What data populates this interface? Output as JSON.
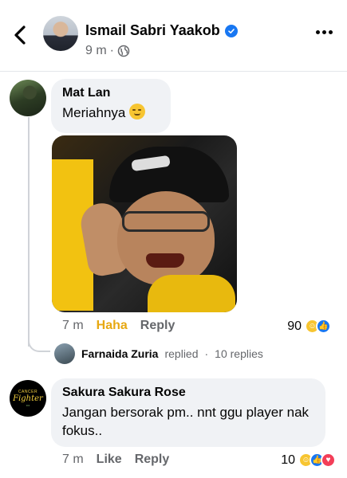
{
  "header": {
    "name": "Ismail Sabri Yaakob",
    "time": "9 m",
    "separator": "·",
    "back_icon": "chevron-left-icon",
    "verified_icon": "verified-badge-icon",
    "privacy_icon": "globe-icon",
    "more_icon": "more-horizontal-icon"
  },
  "comments": [
    {
      "author": "Mat Lan",
      "text": "Meriahnya",
      "emoji": "smirking-face-emoji",
      "attachment": "photo",
      "time": "7 m",
      "reaction_label": "Haha",
      "reply_label": "Reply",
      "reaction_count": "90",
      "reaction_icons": [
        "haha",
        "like"
      ],
      "reply_summary": {
        "name": "Farnaida Zuria",
        "replied": "replied",
        "separator": "·",
        "count": "10 replies"
      }
    },
    {
      "author": "Sakura Sakura Rose",
      "text": "Jangan bersorak pm.. nnt ggu player nak fokus..",
      "time": "7 m",
      "like_label": "Like",
      "reply_label": "Reply",
      "reaction_count": "10",
      "reaction_icons": [
        "haha",
        "like",
        "love"
      ],
      "avatar_text": [
        "CANCER",
        "Fighter"
      ]
    }
  ],
  "colors": {
    "haha": "#e7a811",
    "link_blue": "#1877f2",
    "bubble": "#f0f2f5",
    "secondary_text": "#65676b"
  }
}
